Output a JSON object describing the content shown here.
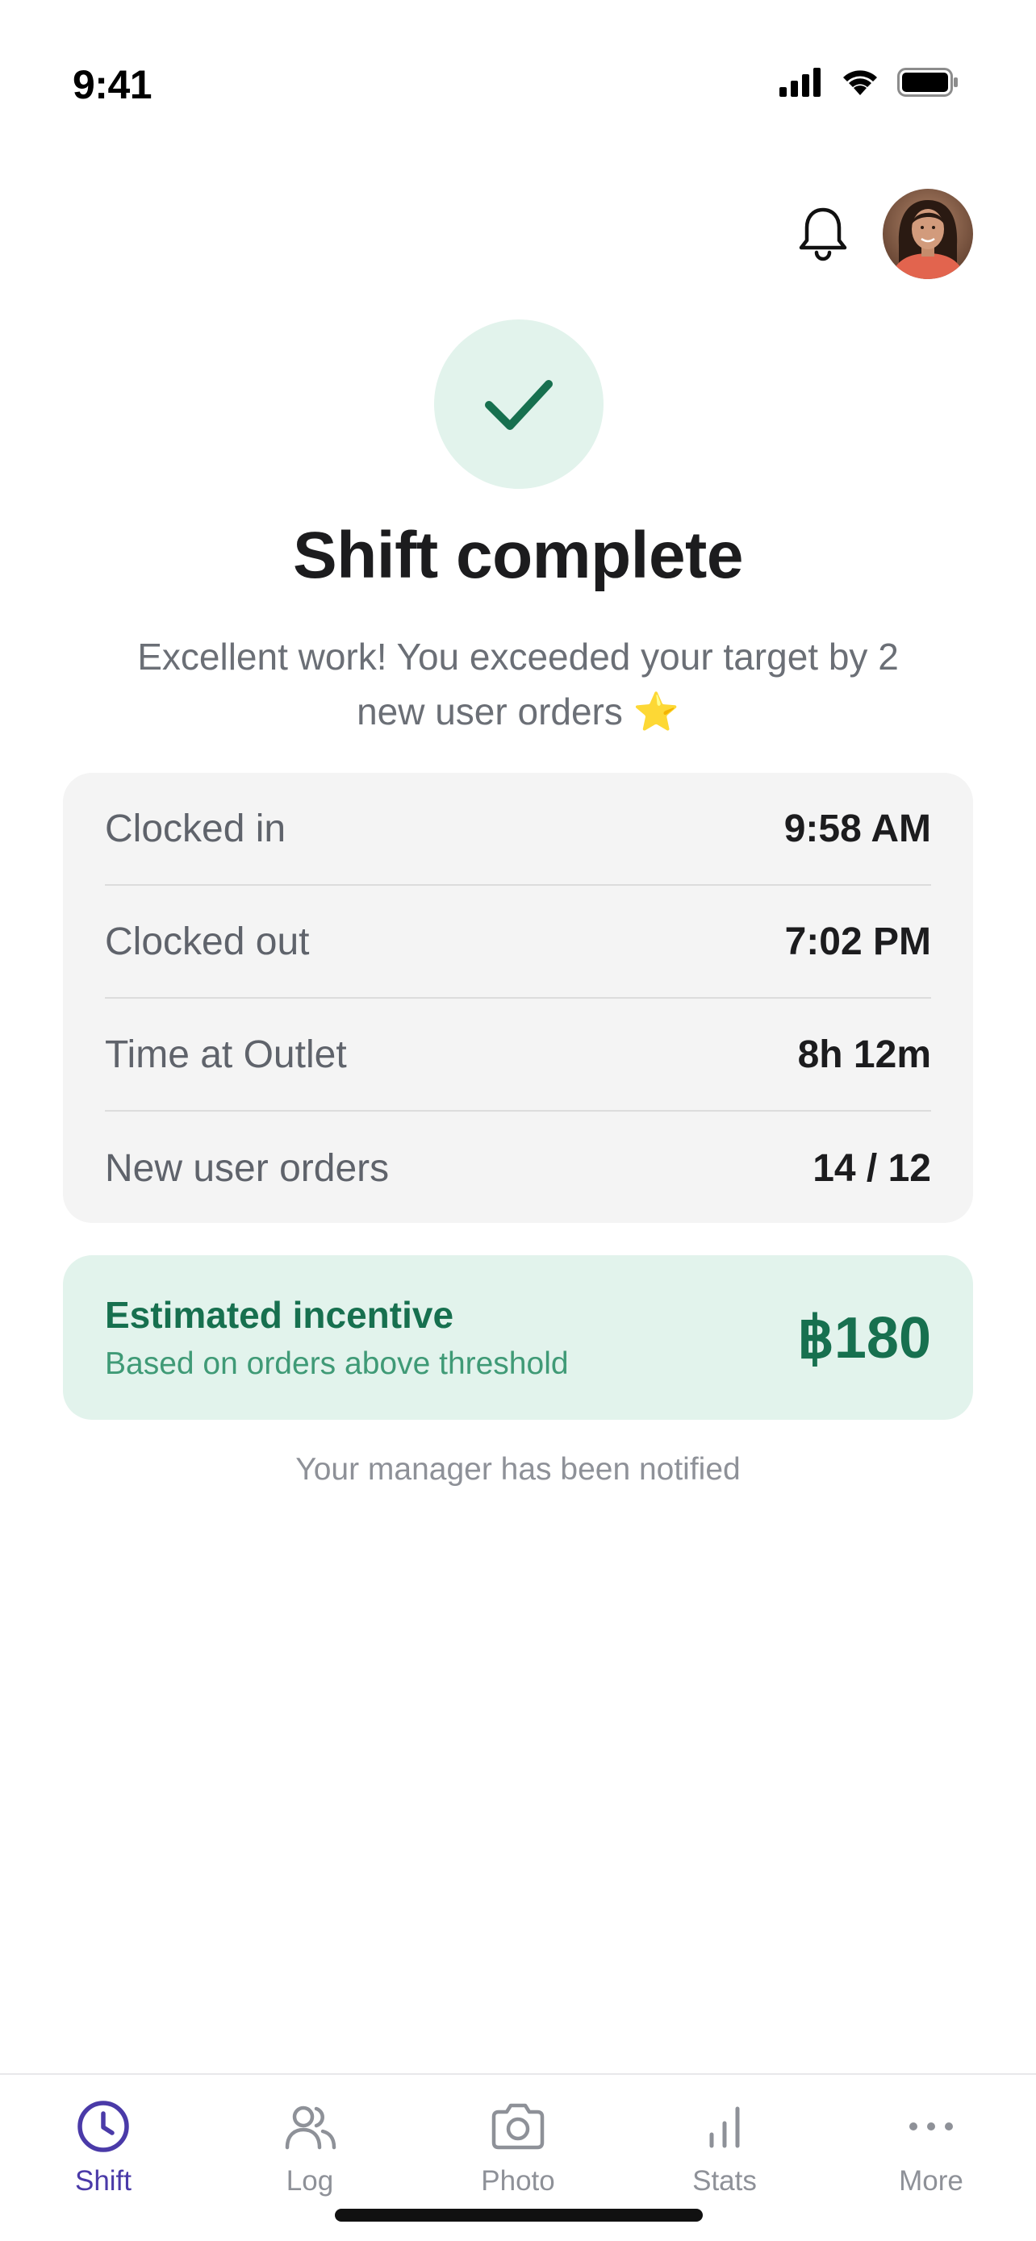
{
  "status_bar": {
    "time": "9:41"
  },
  "header": {
    "bell_icon": "bell-icon",
    "avatar": "user-avatar"
  },
  "completion": {
    "icon": "check-icon",
    "title": "Shift complete",
    "message": "Excellent work! You exceeded your target by 2 new user orders ⭐"
  },
  "summary": {
    "rows": [
      {
        "label": "Clocked in",
        "value": "9:58 AM"
      },
      {
        "label": "Clocked out",
        "value": "7:02 PM"
      },
      {
        "label": "Time at Outlet",
        "value": "8h 12m"
      },
      {
        "label": "New user orders",
        "value": "14 / 12"
      }
    ]
  },
  "incentive": {
    "title": "Estimated incentive",
    "subtitle": "Based on orders above threshold",
    "amount": "฿180"
  },
  "footer_note": "Your manager has been notified",
  "tabs": [
    {
      "label": "Shift",
      "icon": "clock-icon",
      "active": true
    },
    {
      "label": "Log",
      "icon": "users-icon",
      "active": false
    },
    {
      "label": "Photo",
      "icon": "camera-icon",
      "active": false
    },
    {
      "label": "Stats",
      "icon": "bar-chart-icon",
      "active": false
    },
    {
      "label": "More",
      "icon": "more-icon",
      "active": false
    }
  ],
  "colors": {
    "accent_green": "#17704f",
    "green_tint": "#e2f3ec",
    "tab_active": "#4a3aa8",
    "muted_text": "#6b6f76"
  }
}
